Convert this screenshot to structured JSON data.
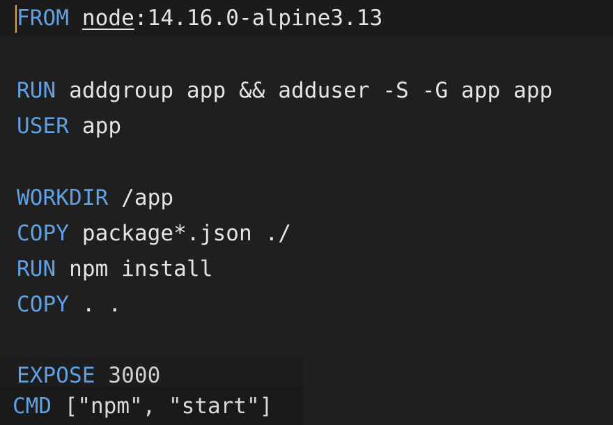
{
  "lines": [
    {
      "keyword": "FROM",
      "image_name": "node",
      "image_tag": ":14.16.0-alpine3.13"
    },
    {
      "keyword": "RUN",
      "args": "addgroup app && adduser -S -G app app"
    },
    {
      "keyword": "USER",
      "args": "app"
    },
    {
      "keyword": "WORKDIR",
      "args": "/app"
    },
    {
      "keyword": "COPY",
      "args": "package*.json ./"
    },
    {
      "keyword": "RUN",
      "args": "npm install"
    },
    {
      "keyword": "COPY",
      "args": ". ."
    },
    {
      "keyword": "EXPOSE",
      "args": "3000"
    },
    {
      "keyword": "CMD",
      "args": "[\"npm\", \"start\"]"
    }
  ],
  "colors": {
    "background": "#1f1f1f",
    "keyword": "#5fa1e3",
    "text": "#e4e4e4",
    "caret": "#e5a544"
  }
}
